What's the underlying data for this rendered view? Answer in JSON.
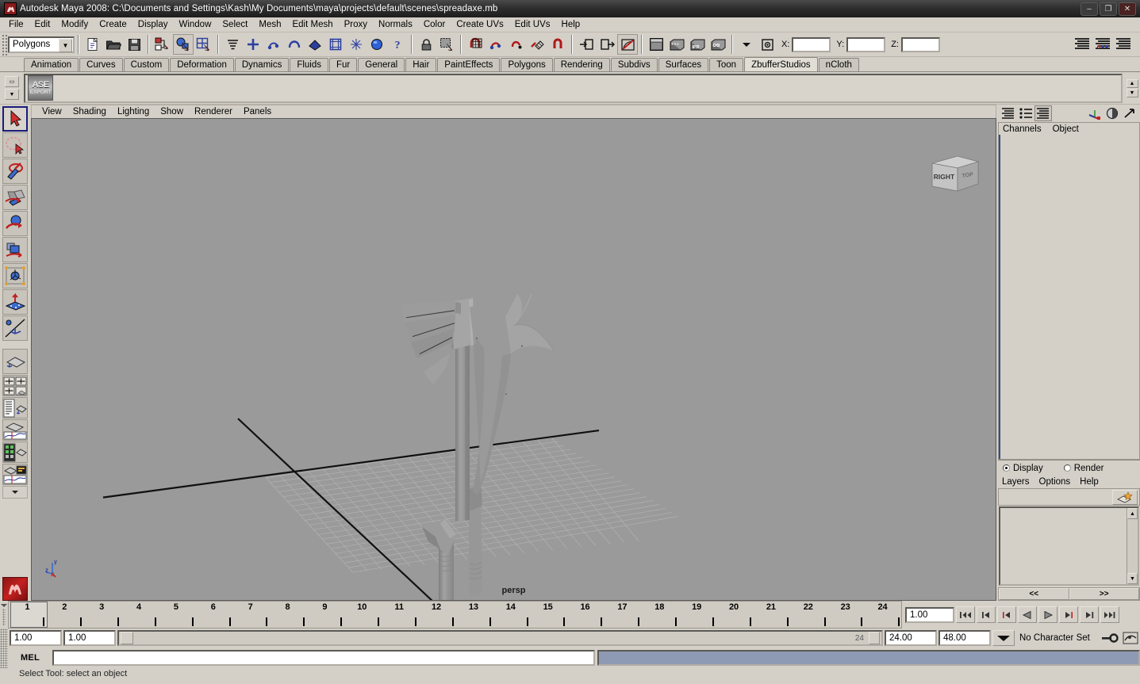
{
  "titlebar": {
    "title": "Autodesk Maya 2008: C:\\Documents and Settings\\Kash\\My Documents\\maya\\projects\\default\\scenes\\spreadaxe.mb",
    "app_icon": "maya-icon",
    "minimize": "–",
    "maximize": "❐",
    "close": "✕"
  },
  "menubar": {
    "items": [
      "File",
      "Edit",
      "Modify",
      "Create",
      "Display",
      "Window",
      "Select",
      "Mesh",
      "Edit Mesh",
      "Proxy",
      "Normals",
      "Color",
      "Create UVs",
      "Edit UVs",
      "Help"
    ]
  },
  "statusline": {
    "mode": "Polygons",
    "coord_labels": {
      "x": "X:",
      "y": "Y:",
      "z": "Z:"
    },
    "coord_values": {
      "x": "",
      "y": "",
      "z": ""
    },
    "icons": [
      "new-scene-icon",
      "open-scene-icon",
      "save-scene-icon",
      "select-by-hierarchy-icon",
      "select-by-object-icon",
      "select-by-component-icon",
      "component-mask-icon",
      "snap-grid-icon",
      "snap-curve-icon",
      "snap-point-icon",
      "snap-view-plane-icon",
      "snap-surface-icon",
      "construction-history-icon",
      "render-current-frame-icon",
      "ipr-render-icon",
      "render-settings-icon",
      "toggle-render-view-icon",
      "input-connections-icon",
      "output-connections-icon",
      "lock-icon",
      "highlight-selection-icon",
      "question-icon",
      "blue-sphere-icon",
      "sidebar-attr-icon",
      "sidebar-tool-icon",
      "sidebar-channel-icon",
      "trash-icon"
    ]
  },
  "shelf": {
    "tabs": [
      "Animation",
      "Curves",
      "Custom",
      "Deformation",
      "Dynamics",
      "Fluids",
      "Fur",
      "General",
      "Hair",
      "PaintEffects",
      "Polygons",
      "Rendering",
      "Subdivs",
      "Surfaces",
      "Toon",
      "ZbufferStudios",
      "nCloth"
    ],
    "active_tab": "ZbufferStudios",
    "buttons": [
      {
        "name": "ase-export-shelf-button",
        "line1": "ASE",
        "line2": "EXPORT"
      }
    ]
  },
  "toolbox": {
    "tools": [
      {
        "name": "select-tool",
        "label": "Select Tool",
        "selected": true
      },
      {
        "name": "lasso-select-tool",
        "label": "Lasso Select Tool",
        "selected": false
      },
      {
        "name": "paint-select-tool",
        "label": "Paint Selection Tool",
        "selected": false
      },
      {
        "name": "move-tool",
        "label": "Move Tool",
        "selected": false
      },
      {
        "name": "rotate-tool",
        "label": "Rotate Tool",
        "selected": false
      },
      {
        "name": "scale-tool",
        "label": "Scale Tool",
        "selected": false
      },
      {
        "name": "universal-manipulator-tool",
        "label": "Universal Manipulator",
        "selected": false
      },
      {
        "name": "soft-modification-tool",
        "label": "Soft Modification Tool",
        "selected": false
      },
      {
        "name": "show-manipulator-tool",
        "label": "Show Manipulator Tool",
        "selected": false
      },
      {
        "name": "single-perspective-layout",
        "label": "Single Perspective View",
        "selected": false
      },
      {
        "name": "four-view-layout",
        "label": "Four View Layout",
        "selected": false
      },
      {
        "name": "outliner-persp-layout",
        "label": "Outliner / Persp Layout",
        "selected": false
      },
      {
        "name": "persp-graph-layout",
        "label": "Persp / Graph Editor Layout",
        "selected": false
      },
      {
        "name": "hypershade-persp-layout",
        "label": "Hypershade / Persp Layout",
        "selected": false
      },
      {
        "name": "persp-trax-graph-layout",
        "label": "Persp / Trax / Graph Layout",
        "selected": false
      },
      {
        "name": "layout-dropdown",
        "label": "More Layouts",
        "selected": false
      },
      {
        "name": "maya-logo",
        "label": "Maya",
        "selected": false
      }
    ]
  },
  "viewport": {
    "menus": [
      "View",
      "Shading",
      "Lighting",
      "Show",
      "Renderer",
      "Panels"
    ],
    "camera_label": "persp",
    "viewcube": {
      "front_face": "RIGHT",
      "side_face": "TOP"
    },
    "axis_indicator": {
      "x": "x",
      "y": "y",
      "z": "z"
    },
    "background_color": "#9a9a9a",
    "model_color": "#9e9e9e",
    "model_name": "spread-axe-model"
  },
  "channelbox": {
    "toolbar_icons": [
      "show-channel-box-icon",
      "show-layer-editor-icon",
      "show-both-icon",
      "attribute-editor-icon",
      "tool-settings-icon",
      "channel-box-icon"
    ],
    "menus": [
      "Channels",
      "Object"
    ],
    "rows": []
  },
  "layer_editor": {
    "display_label": "Display",
    "render_label": "Render",
    "display_selected": true,
    "menus": [
      "Layers",
      "Options",
      "Help"
    ],
    "new_layer_icon": "new-layer-icon",
    "layers": [],
    "nav_prev": "<<",
    "nav_next": ">>"
  },
  "timeline": {
    "ticks": [
      1,
      2,
      3,
      4,
      5,
      6,
      7,
      8,
      9,
      10,
      11,
      12,
      13,
      14,
      15,
      16,
      17,
      18,
      19,
      20,
      21,
      22,
      23,
      24
    ],
    "current_frame": "1.00",
    "start_frame": "1.00",
    "range_start": "1.00",
    "range_end": "24.00",
    "anim_end": "48.00",
    "range_slider_label": "24",
    "playback_buttons": [
      {
        "name": "go-to-start-button",
        "glyph": "|◀◀"
      },
      {
        "name": "step-back-frames-button",
        "glyph": "|◀"
      },
      {
        "name": "step-back-key-button",
        "glyph": "|◀"
      },
      {
        "name": "play-backwards-button",
        "glyph": "◀"
      },
      {
        "name": "play-forwards-button",
        "glyph": "▶"
      },
      {
        "name": "step-forward-key-button",
        "glyph": "▶|"
      },
      {
        "name": "step-forward-frames-button",
        "glyph": "▶|"
      },
      {
        "name": "go-to-end-button",
        "glyph": "▶▶|"
      }
    ],
    "character_set": "No Character Set",
    "auto_key_icon": "auto-keyframe-icon",
    "anim_prefs_icon": "animation-preferences-icon"
  },
  "command_line": {
    "label": "MEL",
    "input_value": "",
    "output_value": ""
  },
  "status_message": "Select Tool: select an object"
}
